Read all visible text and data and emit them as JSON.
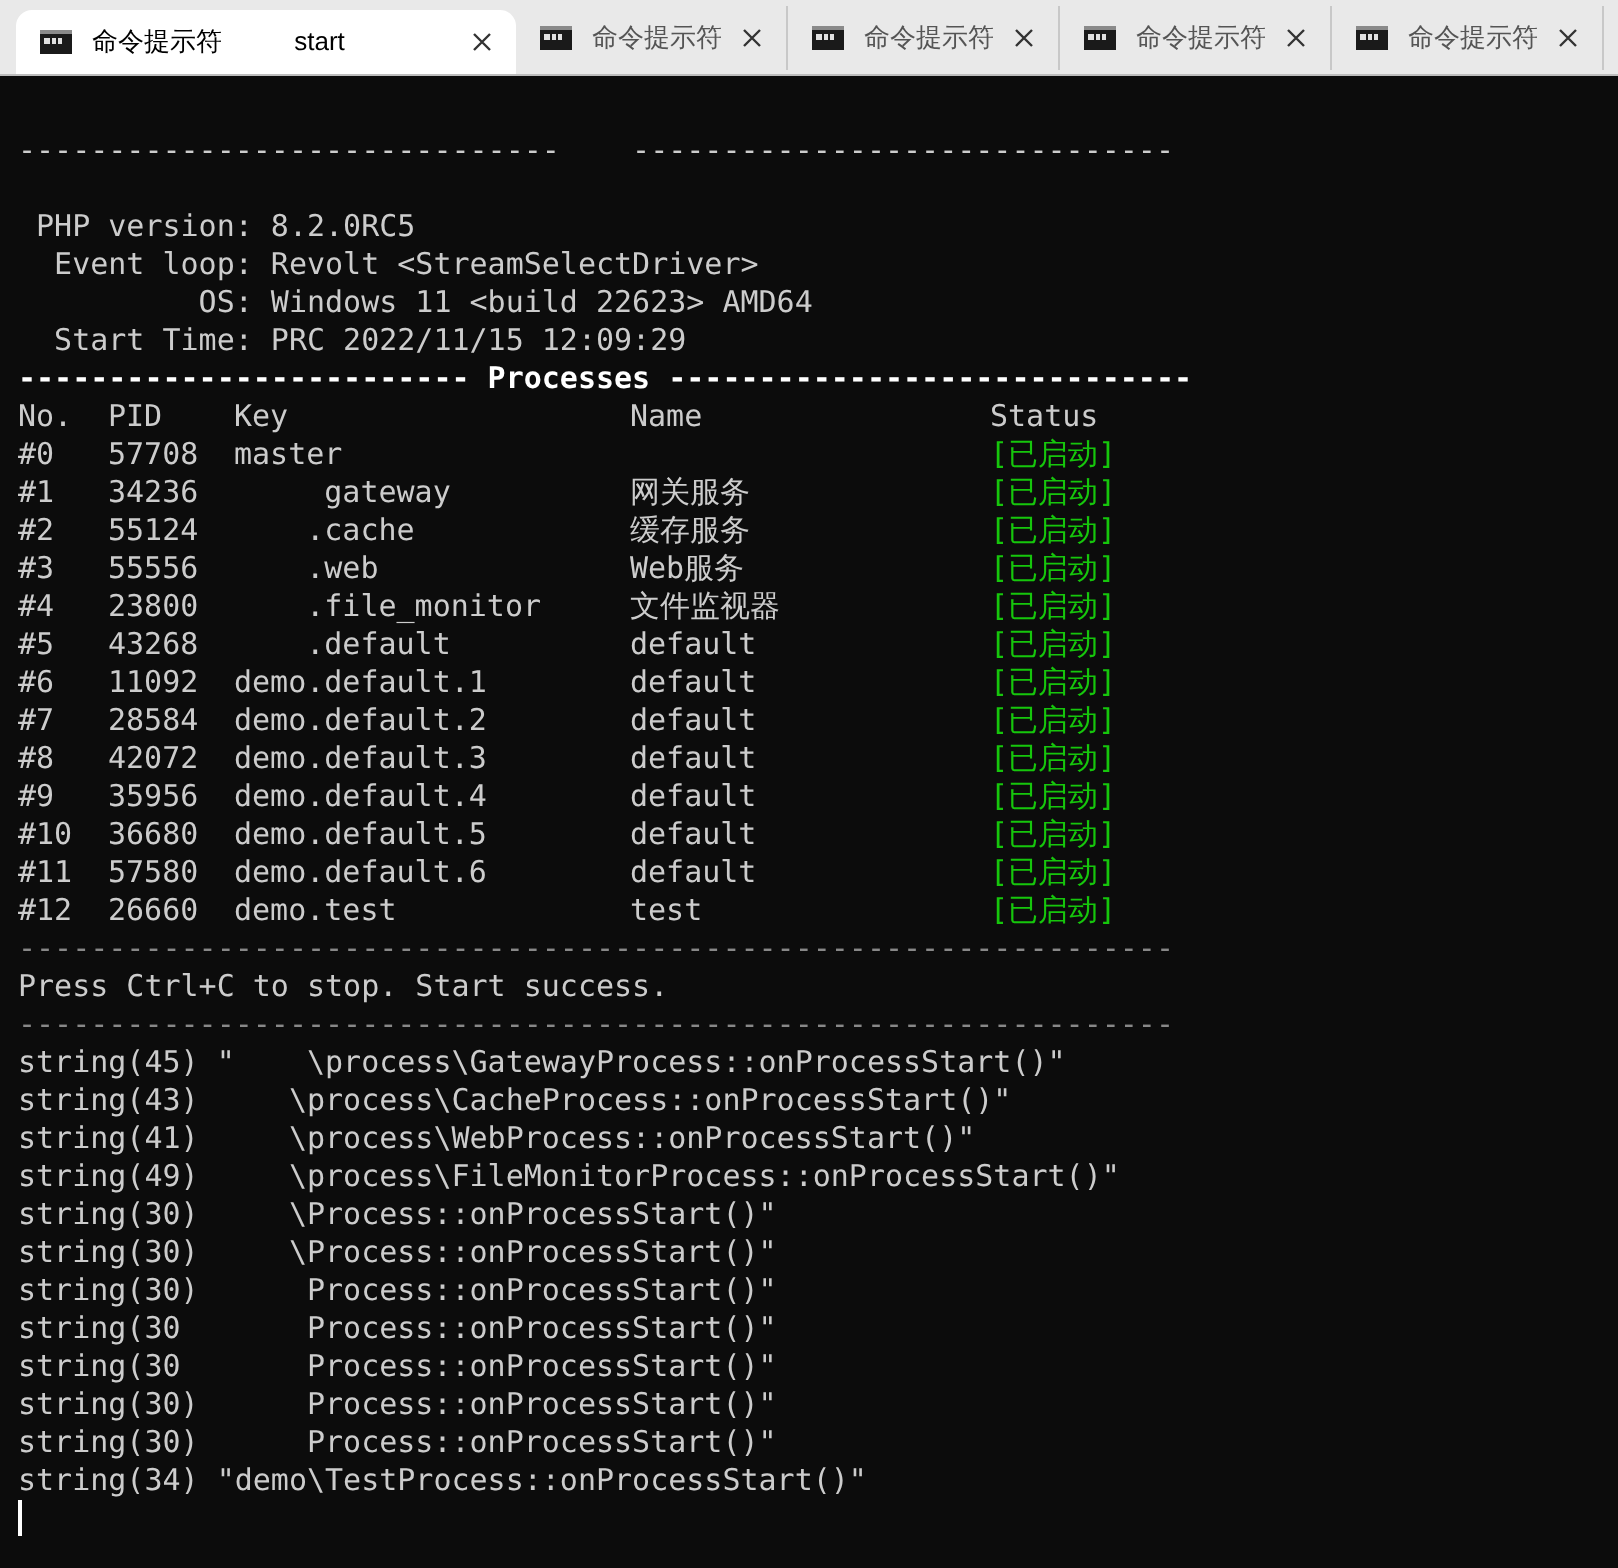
{
  "tabs": [
    {
      "title": "命令提示符          start",
      "selected": true
    },
    {
      "title": "命令提示符",
      "selected": false
    },
    {
      "title": "命令提示符",
      "selected": false
    },
    {
      "title": "命令提示符",
      "selected": false
    },
    {
      "title": "命令提示符",
      "selected": false
    }
  ],
  "terminal": {
    "banner": [
      "------------------------------    ------------------------------"
    ],
    "info": [
      " PHP version: 8.2.0RC5",
      "  Event loop: Revolt <StreamSelectDriver>",
      "          OS: Windows 11 <build 22623> AMD64",
      "  Start Time: PRC 2022/11/15 12:09:29"
    ],
    "section_title": "------------------------- Processes -----------------------------",
    "columns": [
      "No.",
      "PID",
      "Key",
      "Name",
      "Status"
    ],
    "processes": [
      {
        "no": "#0",
        "pid": "57708",
        "key": "master",
        "status": "[已启动]"
      },
      {
        "no": "#1",
        "pid": "34236",
        "key": "     gateway",
        "name": "网关服务",
        "status": "[已启动]"
      },
      {
        "no": "#2",
        "pid": "55124",
        "key": "    .cache",
        "name": "缓存服务",
        "status": "[已启动]"
      },
      {
        "no": "#3",
        "pid": "55556",
        "key": "    .web",
        "name": "Web服务",
        "status": "[已启动]"
      },
      {
        "no": "#4",
        "pid": "23800",
        "key": "    .file_monitor",
        "name": "文件监视器",
        "status": "[已启动]"
      },
      {
        "no": "#5",
        "pid": "43268",
        "key": "    .default",
        "name": "default",
        "status": "[已启动]"
      },
      {
        "no": "#6",
        "pid": "11092",
        "key": "demo.default.1",
        "name": "default",
        "status": "[已启动]"
      },
      {
        "no": "#7",
        "pid": "28584",
        "key": "demo.default.2",
        "name": "default",
        "status": "[已启动]"
      },
      {
        "no": "#8",
        "pid": "42072",
        "key": "demo.default.3",
        "name": "default",
        "status": "[已启动]"
      },
      {
        "no": "#9",
        "pid": "35956",
        "key": "demo.default.4",
        "name": "default",
        "status": "[已启动]"
      },
      {
        "no": "#10",
        "pid": "36680",
        "key": "demo.default.5",
        "name": "default",
        "status": "[已启动]"
      },
      {
        "no": "#11",
        "pid": "57580",
        "key": "demo.default.6",
        "name": "default",
        "status": "[已启动]"
      },
      {
        "no": "#12",
        "pid": "26660",
        "key": "demo.test",
        "name": "test",
        "status": "[已启动]"
      }
    ],
    "divider": "----------------------------------------------------------------",
    "message": "Press Ctrl+C to stop. Start success.",
    "divider_2": "----------------------------------------------------------------",
    "output": [
      "string(45) \"    \\process\\GatewayProcess::onProcessStart()\"",
      "string(43)     \\process\\CacheProcess::onProcessStart()\"",
      "string(41)     \\process\\WebProcess::onProcessStart()\"",
      "string(49)     \\process\\FileMonitorProcess::onProcessStart()\"",
      "string(30)     \\Process::onProcessStart()\"",
      "string(30)     \\Process::onProcessStart()\"",
      "string(30)      Process::onProcessStart()\"",
      "string(30       Process::onProcessStart()\"",
      "string(30       Process::onProcessStart()\"",
      "string(30)      Process::onProcessStart()\"",
      "string(30)      Process::onProcessStart()\"",
      "string(34) \"demo\\TestProcess::onProcessStart()\""
    ]
  }
}
